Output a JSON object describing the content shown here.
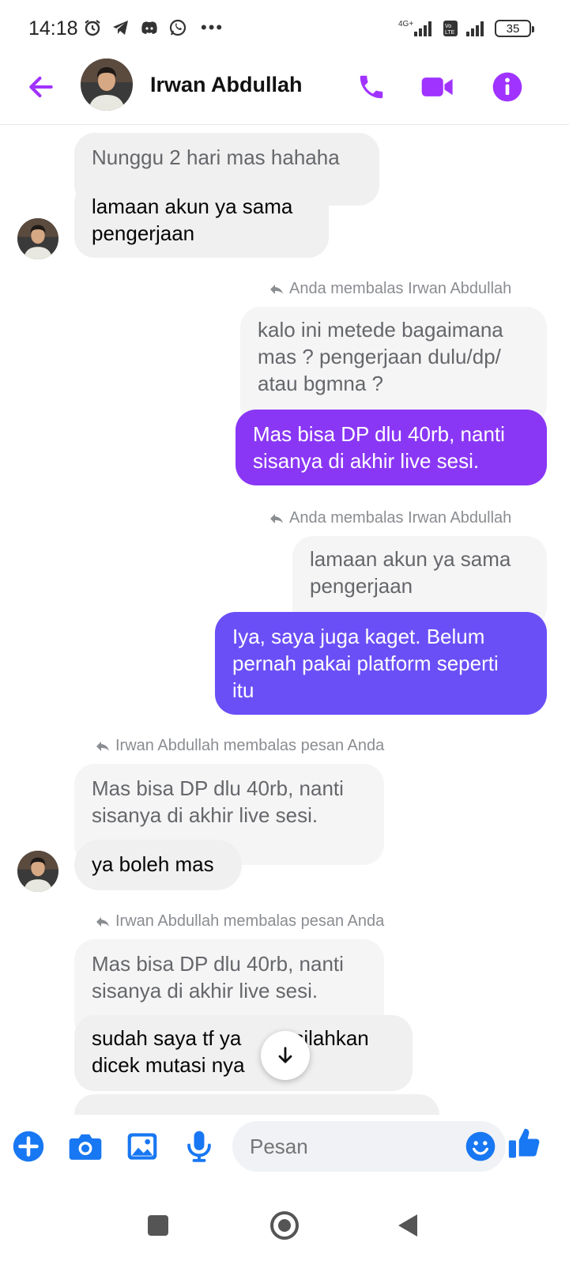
{
  "status_bar": {
    "time": "14:18",
    "battery": "35",
    "network_labels": "4G+"
  },
  "header": {
    "contact_name": "Irwan Abdullah",
    "accent_color": "#a033ff"
  },
  "messages": {
    "m1": "Nunggu 2 hari mas hahaha",
    "m2_line1": "lamaan akun ya sama",
    "m2_line2": "pengerjaan",
    "reply_label_1": "Anda membalas Irwan Abdullah",
    "q1_line1": "kalo ini metede bagaimana",
    "q1_line2": "mas ? pengerjaan dulu/dp/",
    "q1_line3": "atau bgmna ?",
    "o1_line1": "Mas bisa DP dlu 40rb, nanti",
    "o1_line2": "sisanya di akhir live sesi.",
    "reply_label_2": "Anda membalas Irwan Abdullah",
    "q2_line1": "lamaan akun ya sama",
    "q2_line2": "pengerjaan",
    "o2_line1": "Iya, saya juga kaget. Belum",
    "o2_line2": "pernah pakai platform seperti",
    "o2_line3": "itu",
    "reply_label_3": "Irwan Abdullah membalas pesan Anda",
    "q3_line1": "Mas bisa DP dlu 40rb, nanti",
    "q3_line2": "sisanya di akhir live sesi.",
    "m3": "ya boleh mas",
    "reply_label_4": "Irwan Abdullah membalas pesan Anda",
    "q4_line1": "Mas bisa DP dlu 40rb, nanti",
    "q4_line2": "sisanya di akhir live sesi.",
    "m4_line1": "sudah saya tf ya",
    "m4_line1_end": "silahkan",
    "m4_line2": "dicek mutasi nya"
  },
  "composer": {
    "placeholder": "Pesan"
  },
  "colors": {
    "outgoing_purple": "#8a37f5",
    "outgoing_indigo": "#6a4ff7",
    "composer_blue": "#1877f2"
  }
}
